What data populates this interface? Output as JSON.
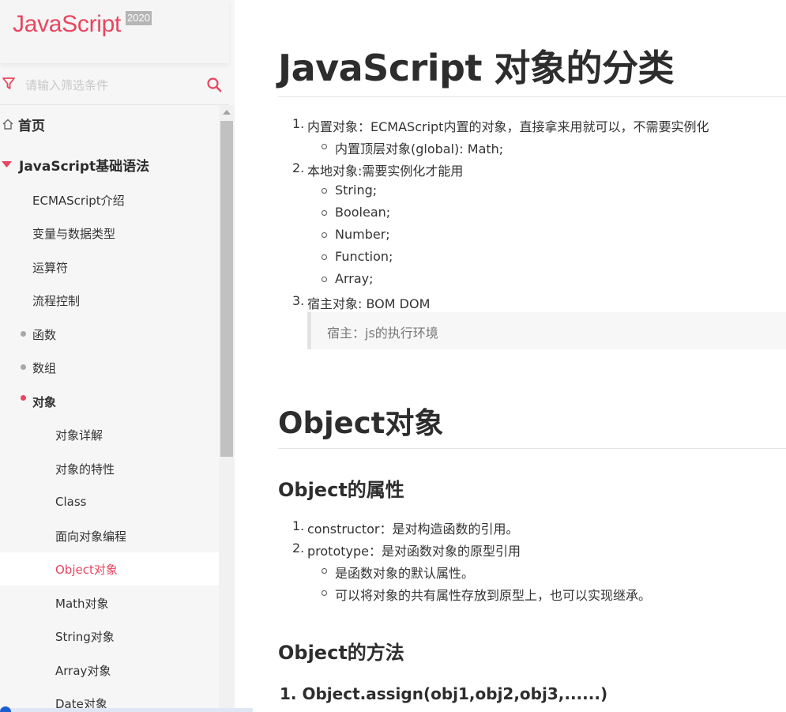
{
  "brand": {
    "title": "JavaScript",
    "year": "2020"
  },
  "search": {
    "placeholder": "请输入筛选条件"
  },
  "sidebar": {
    "items": [
      {
        "label": "首页"
      },
      {
        "label": "JavaScript基础语法"
      },
      {
        "label": "ECMAScript介绍"
      },
      {
        "label": "变量与数据类型"
      },
      {
        "label": "运算符"
      },
      {
        "label": "流程控制"
      },
      {
        "label": "函数"
      },
      {
        "label": "数组"
      },
      {
        "label": "对象"
      },
      {
        "label": "对象详解"
      },
      {
        "label": "对象的特性"
      },
      {
        "label": "Class"
      },
      {
        "label": "面向对象编程"
      },
      {
        "label": "Object对象"
      },
      {
        "label": "Math对象"
      },
      {
        "label": "String对象"
      },
      {
        "label": "Array对象"
      },
      {
        "label": "Date对象"
      }
    ]
  },
  "article": {
    "title": "JavaScript 对象的分类",
    "list1": [
      {
        "num": "1.",
        "text": "内置对象：ECMAScript内置的对象，直接拿来用就可以，不需要实例化",
        "sub": [
          "内置顶层对象(global): Math;"
        ]
      },
      {
        "num": "2.",
        "text": "本地对象:需要实例化才能用",
        "sub": [
          "String;",
          "Boolean;",
          "Number;",
          "Function;",
          "Array;"
        ]
      },
      {
        "num": "3.",
        "text": "宿主对象: BOM DOM",
        "sub": []
      }
    ],
    "quote": "宿主：js的执行环境",
    "section_title": "Object对象",
    "props_title": "Object的属性",
    "props": [
      {
        "num": "1.",
        "text": "constructor：是对构造函数的引用。"
      },
      {
        "num": "2.",
        "text": "prototype：是对函数对象的原型引用",
        "sub": [
          "是函数对象的默认属性。",
          "可以将对象的共有属性存放到原型上，也可以实现继承。"
        ]
      }
    ],
    "methods_title": "Object的方法",
    "method1": "1. Object.assign(obj1,obj2,obj3,......)"
  },
  "colors": {
    "accent": "#e8465f",
    "text": "#333333",
    "sidebar_bg": "#f6f6f6"
  }
}
